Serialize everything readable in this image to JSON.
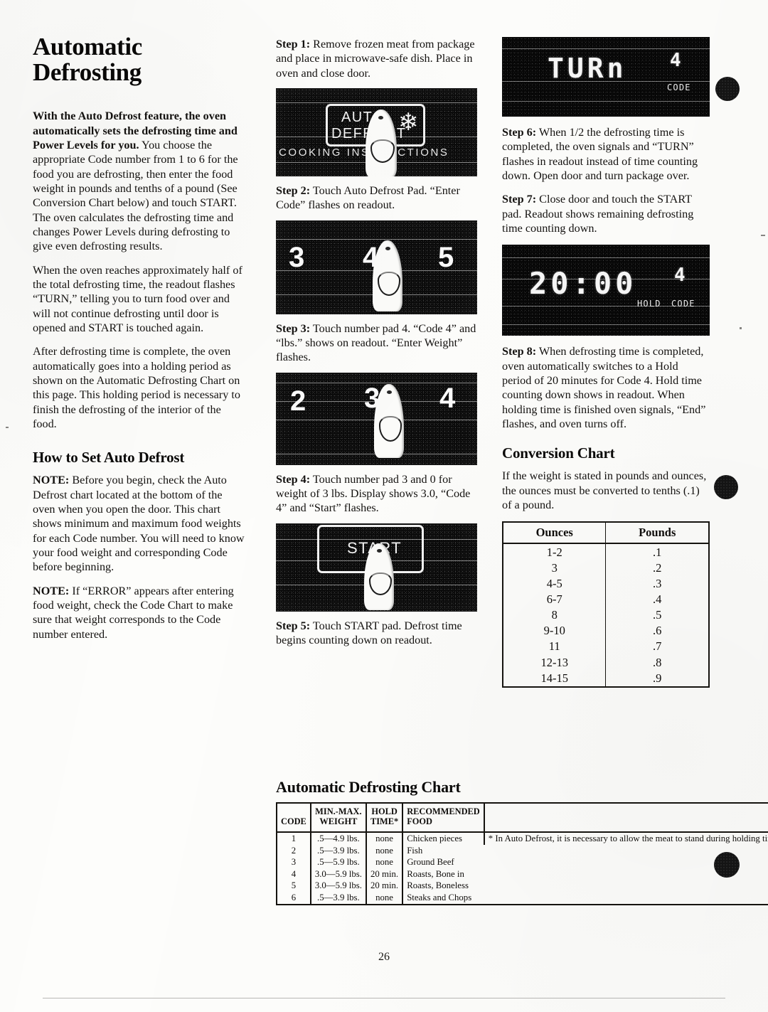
{
  "page": {
    "title": "Automatic\nDefrosting",
    "title_line1": "Automatic",
    "title_line2": "Defrosting",
    "number": "26"
  },
  "intro": {
    "p1": "With the Auto Defrost feature, the oven automatically sets the defrosting time and Power Levels for you.",
    "p1_rest": " You choose the appropriate Code number from 1 to 6 for the food you are defrosting, then enter the food weight in pounds and tenths of a pound (See Conversion Chart below) and touch START. The oven calculates the defrosting time and changes Power Levels during defrosting to give even defrosting results.",
    "p2": "When the oven reaches approximately half of the total defrosting time, the readout flashes “TURN,” telling you to turn food over and will not continue defrosting until door is opened and START is touched again.",
    "p3": "After defrosting time is complete, the oven automatically goes into a holding period as shown on the Automatic Defrosting Chart on this page. This holding period is necessary to finish the defrosting of the interior of the food."
  },
  "how_to": {
    "heading": "How to Set Auto Defrost",
    "note1_label": "NOTE:",
    "note1": " Before you begin, check the Auto Defrost chart located at the bottom of the oven when you open the door. This chart shows minimum and maximum food weights for each Code number. You will need to know your food weight and corresponding Code before beginning.",
    "note2_label": "NOTE:",
    "note2": " If “ERROR” appears after entering food weight, check the Code Chart to make sure that weight corresponds to the Code number entered."
  },
  "steps": [
    {
      "label": "Step 1:",
      "text": " Remove frozen meat from package and place in microwave-safe dish. Place in oven and close door."
    },
    {
      "label": "Step 2:",
      "text": " Touch Auto Defrost Pad. “Enter Code” flashes on readout."
    },
    {
      "label": "Step 3:",
      "text": " Touch number pad 4. “Code 4” and “lbs.” shows on readout. “Enter Weight” flashes."
    },
    {
      "label": "Step 4:",
      "text": " Touch number pad 3 and 0 for weight of 3 lbs. Display shows 3.0, “Code 4” and “Start” flashes."
    },
    {
      "label": "Step 5:",
      "text": " Touch START pad. Defrost time begins counting down on readout."
    },
    {
      "label": "Step 6:",
      "text": " When 1/2 the defrosting time is completed, the oven signals and “TURN” flashes in readout instead of time counting down. Open door and turn package over."
    },
    {
      "label": "Step 7:",
      "text": " Close door and touch the START pad. Readout shows remaining defrosting time counting down."
    },
    {
      "label": "Step 8:",
      "text": " When defrosting time is completed, oven automatically switches to a Hold period of 20 minutes for Code 4. Hold time counting down shows in readout. When holding time is finished oven signals, “End” flashes, and oven turns off."
    }
  ],
  "photos": {
    "auto_defrost_pad": {
      "pad_line1": "AUTO",
      "pad_line2": "DEFROST",
      "panel_label": "COOKING INSTRUCTIONS",
      "icon": "snowflake"
    },
    "numpad_345": {
      "digits": [
        "3",
        "4",
        "5"
      ],
      "pressed": "4"
    },
    "numpad_234": {
      "digits": [
        "2",
        "3",
        "4"
      ],
      "pressed": "3"
    },
    "start_pad": {
      "pad_label": "START"
    }
  },
  "displays": {
    "turn": {
      "main": "TURn",
      "code_value": "4",
      "code_label": "CODE"
    },
    "hold": {
      "main": "20:00",
      "code_value": "4",
      "hold_label": "HOLD",
      "code_label": "CODE"
    }
  },
  "conversion": {
    "heading": "Conversion Chart",
    "intro": "If the weight is stated in pounds and ounces, the ounces must be converted to tenths (.1) of a pound.",
    "headers": [
      "Ounces",
      "Pounds"
    ],
    "rows": [
      [
        "1-2",
        ".1"
      ],
      [
        "3",
        ".2"
      ],
      [
        "4-5",
        ".3"
      ],
      [
        "6-7",
        ".4"
      ],
      [
        "8",
        ".5"
      ],
      [
        "9-10",
        ".6"
      ],
      [
        "11",
        ".7"
      ],
      [
        "12-13",
        ".8"
      ],
      [
        "14-15",
        ".9"
      ]
    ]
  },
  "defrost_chart": {
    "heading": "Automatic Defrosting Chart",
    "headers": {
      "code": "CODE",
      "weight_line1": "MIN.-MAX.",
      "weight_line2": "WEIGHT",
      "hold_line1": "HOLD",
      "hold_line2": "TIME*",
      "food_line1": "RECOMMENDED",
      "food_line2": "FOOD",
      "note": ""
    },
    "rows": [
      {
        "code": "1",
        "weight": ".5—4.9 lbs.",
        "hold": "none",
        "food": "Chicken pieces"
      },
      {
        "code": "2",
        "weight": ".5—3.9 lbs.",
        "hold": "none",
        "food": "Fish"
      },
      {
        "code": "3",
        "weight": ".5—5.9 lbs.",
        "hold": "none",
        "food": "Ground Beef"
      },
      {
        "code": "4",
        "weight": "3.0—5.9 lbs.",
        "hold": "20 min.",
        "food": "Roasts, Bone in"
      },
      {
        "code": "5",
        "weight": "3.0—5.9 lbs.",
        "hold": "20 min.",
        "food": "Roasts, Boneless"
      },
      {
        "code": "6",
        "weight": ".5—3.9 lbs.",
        "hold": "none",
        "food": "Steaks and Chops"
      }
    ],
    "footnote": "* In Auto Defrost, it is necessary to allow the meat to stand during holding time. You may take the meat out of the oven if you prefer."
  }
}
